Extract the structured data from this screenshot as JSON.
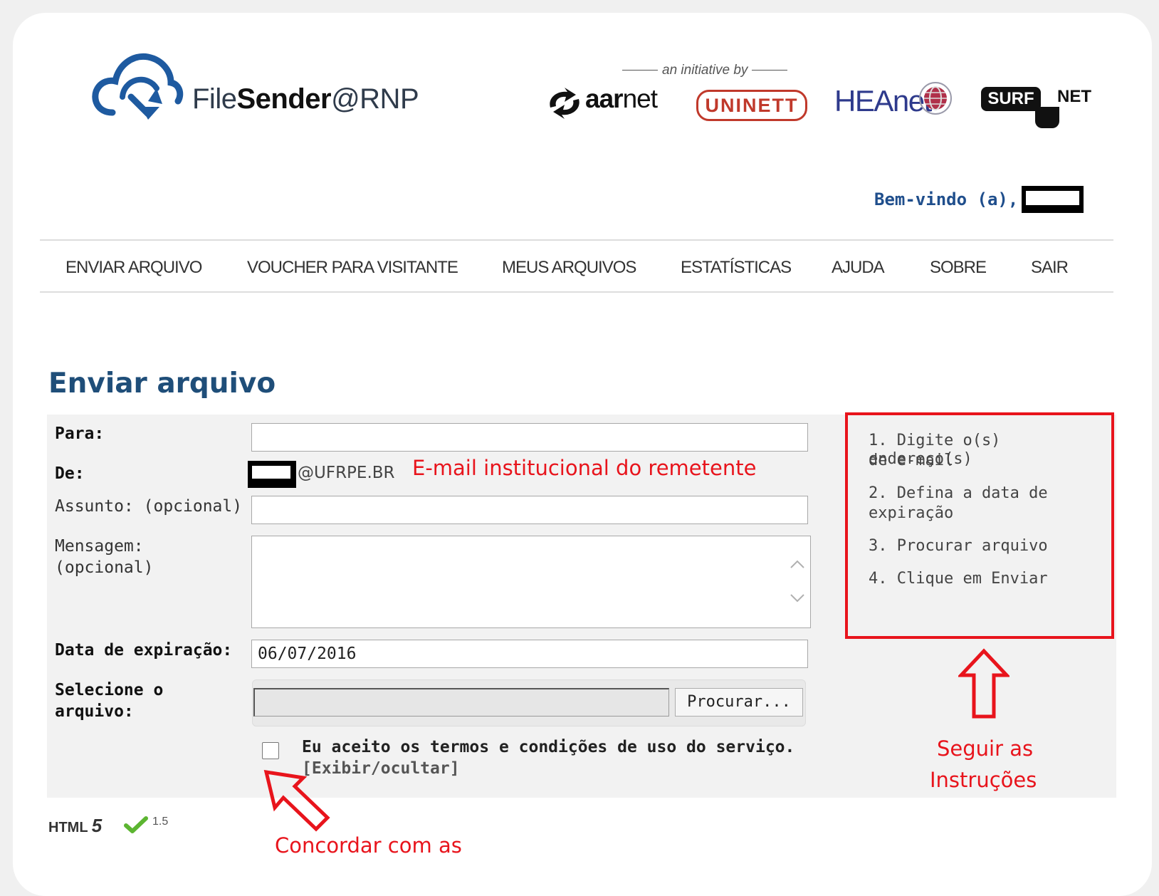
{
  "header": {
    "brand": {
      "prefix": "File",
      "bold": "Sender",
      "suffix": "@RNP"
    },
    "initiative": "an initiative by",
    "partners": {
      "aarnet_bold": "aar",
      "aarnet_rest": "net",
      "uninett": "UNINETT",
      "heanet": "HEAnet",
      "surf": "SURF",
      "net": "NET"
    },
    "welcome": "Bem-vindo (a),"
  },
  "nav": {
    "items": [
      "ENVIAR ARQUIVO",
      "VOUCHER PARA VISITANTE",
      "MEUS ARQUIVOS",
      "ESTATÍSTICAS",
      "AJUDA",
      "SOBRE",
      "SAIR"
    ]
  },
  "page": {
    "title": "Enviar arquivo"
  },
  "form": {
    "to_label": "Para:",
    "to_value": "",
    "from_label": "De:",
    "from_domain": "@UFRPE.BR",
    "subject_label": "Assunto: (opcional)",
    "subject_value": "",
    "message_label_1": "Mensagem:",
    "message_label_2": "(opcional)",
    "message_value": "",
    "expiry_label": "Data de expiração:",
    "expiry_value": "06/07/2016",
    "file_label_1": "Selecione o",
    "file_label_2": "arquivo:",
    "browse_button": "Procurar...",
    "terms_text": "Eu aceito os termos e condições de uso do serviço.",
    "terms_toggle": "[Exibir/ocultar]"
  },
  "instructions": {
    "step1a": "1. Digite o(s) endereço(s)",
    "step1b": "de e-mail",
    "step2a": "2. Defina a data de",
    "step2b": "expiração",
    "step3": "3. Procurar arquivo",
    "step4": "4. Clique em Enviar"
  },
  "annotations": {
    "sender_note": "E-mail institucional do remetente",
    "follow_1": "Seguir as",
    "follow_2": "Instruções",
    "agree": "Concordar com as"
  },
  "footer": {
    "html_label": "HTML",
    "html_version_mark": "5",
    "version": "1.5"
  },
  "colors": {
    "annotation_red": "#e8141c",
    "brand_blue": "#1f4e79",
    "welcome_blue": "#1f4e8c",
    "check_green": "#5cb531"
  }
}
